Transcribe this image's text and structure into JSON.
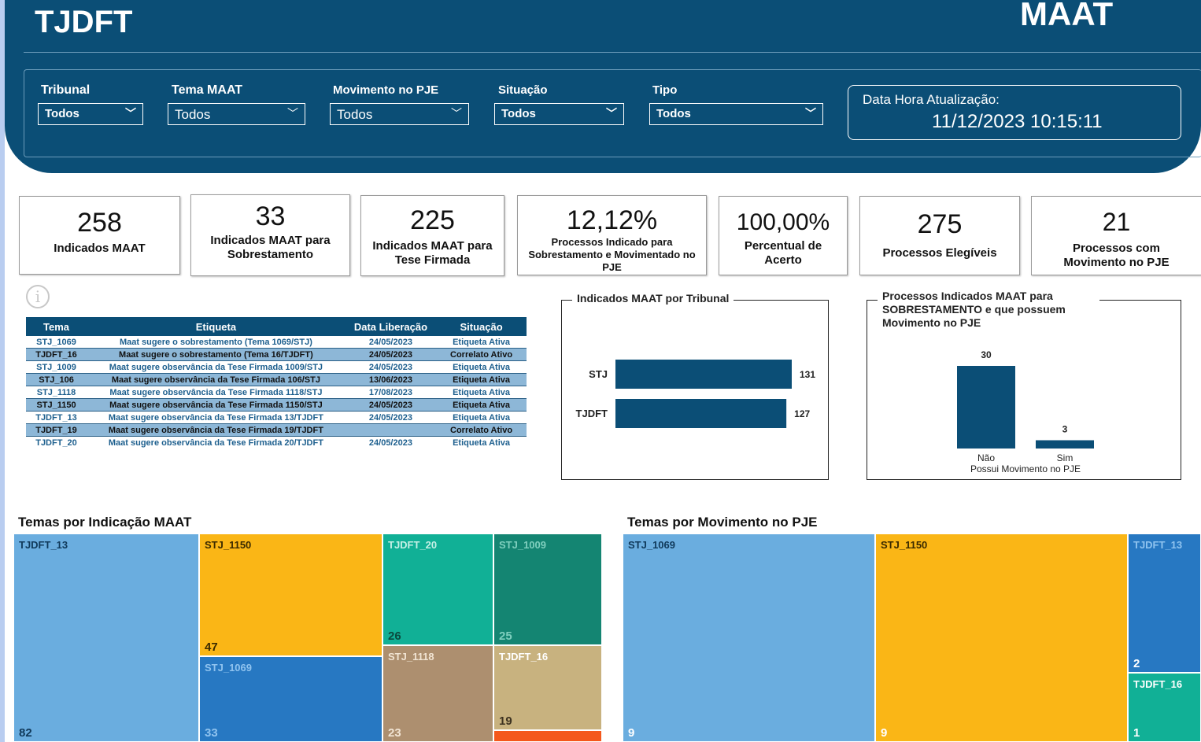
{
  "header": {
    "brand": "TJDFT",
    "app_title": "MAAT",
    "filters": [
      {
        "label": "Tribunal",
        "value": "Todos"
      },
      {
        "label": "Tema MAAT",
        "value": "Todos"
      },
      {
        "label": "Movimento no PJE",
        "value": "Todos"
      },
      {
        "label": "Situação",
        "value": "Todos"
      },
      {
        "label": "Tipo",
        "value": "Todos"
      }
    ],
    "update_label": "Data Hora Atualização:",
    "update_value": "11/12/2023 10:15:11"
  },
  "cards": [
    {
      "value": "258",
      "label": "Indicados MAAT"
    },
    {
      "value": "33",
      "label": "Indicados MAAT para Sobrestamento"
    },
    {
      "value": "225",
      "label": "Indicados MAAT para Tese Firmada"
    },
    {
      "value": "12,12%",
      "label": "Processos Indicado para Sobrestamento e Movimentado no PJE"
    },
    {
      "value": "100,00%",
      "label": "Percentual de Acerto"
    },
    {
      "value": "275",
      "label": "Processos Elegíveis"
    },
    {
      "value": "21",
      "label": "Processos com Movimento no PJE"
    }
  ],
  "info_icon": "info-icon",
  "table": {
    "headers": [
      "Tema",
      "Etiqueta",
      "Data Liberação",
      "Situação"
    ],
    "rows": [
      [
        "STJ_1069",
        "Maat sugere o sobrestamento (Tema 1069/STJ)",
        "24/05/2023",
        "Etiqueta Ativa"
      ],
      [
        "TJDFT_16",
        "Maat sugere o sobrestamento (Tema 16/TJDFT)",
        "24/05/2023",
        "Correlato Ativo"
      ],
      [
        "STJ_1009",
        "Maat sugere observância da Tese Firmada 1009/STJ",
        "24/05/2023",
        "Etiqueta Ativa"
      ],
      [
        "STJ_106",
        "Maat sugere observância da Tese Firmada 106/STJ",
        "13/06/2023",
        "Etiqueta Ativa"
      ],
      [
        "STJ_1118",
        "Maat sugere observância da Tese Firmada 1118/STJ",
        "17/08/2023",
        "Etiqueta Ativa"
      ],
      [
        "STJ_1150",
        "Maat sugere observância da Tese Firmada 1150/STJ",
        "24/05/2023",
        "Etiqueta Ativa"
      ],
      [
        "TJDFT_13",
        "Maat sugere observância da Tese Firmada 13/TJDFT",
        "24/05/2023",
        "Etiqueta Ativa"
      ],
      [
        "TJDFT_19",
        "Maat sugere observância da Tese Firmada 19/TJDFT",
        "",
        "Correlato Ativo"
      ],
      [
        "TJDFT_20",
        "Maat sugere observância da Tese Firmada 20/TJDFT",
        "24/05/2023",
        "Etiqueta Ativa"
      ]
    ]
  },
  "colors": {
    "brand": "#0b4e76",
    "bar": "#0b4e76",
    "tm_light_blue": "#6aaddf",
    "tm_yellow": "#fab616",
    "tm_teal": "#11b096",
    "tm_dark_teal": "#148572",
    "tm_blue": "#2778c2",
    "tm_brown": "#ad8f6f",
    "tm_khaki": "#c8b27f",
    "tm_orange": "#f4581c"
  },
  "chart_data": [
    {
      "type": "bar",
      "orientation": "horizontal",
      "title": "Indicados MAAT por Tribunal",
      "categories": [
        "STJ",
        "TJDFT"
      ],
      "values": [
        131,
        127
      ],
      "xlim": [
        0,
        131
      ]
    },
    {
      "type": "bar",
      "title": "Processos Indicados MAAT para SOBRESTAMENTO e que possuem Movimento no PJE",
      "xlabel": "Possui Movimento no PJE",
      "categories": [
        "Não",
        "Sim"
      ],
      "values": [
        30,
        3
      ],
      "ylim": [
        0,
        30
      ]
    }
  ],
  "treemap1": {
    "title": "Temas por Indicação MAAT",
    "items": [
      {
        "label": "TJDFT_13",
        "value": "82"
      },
      {
        "label": "STJ_1150",
        "value": "47"
      },
      {
        "label": "STJ_1069",
        "value": "33"
      },
      {
        "label": "TJDFT_20",
        "value": "26"
      },
      {
        "label": "STJ_1009",
        "value": "25"
      },
      {
        "label": "STJ_1118",
        "value": "23"
      },
      {
        "label": "TJDFT_16",
        "value": "19"
      }
    ]
  },
  "treemap2": {
    "title": "Temas por Movimento no PJE",
    "items": [
      {
        "label": "STJ_1069",
        "value": "9"
      },
      {
        "label": "STJ_1150",
        "value": "9"
      },
      {
        "label": "TJDFT_13",
        "value": "2"
      },
      {
        "label": "TJDFT_16",
        "value": "1"
      }
    ]
  }
}
